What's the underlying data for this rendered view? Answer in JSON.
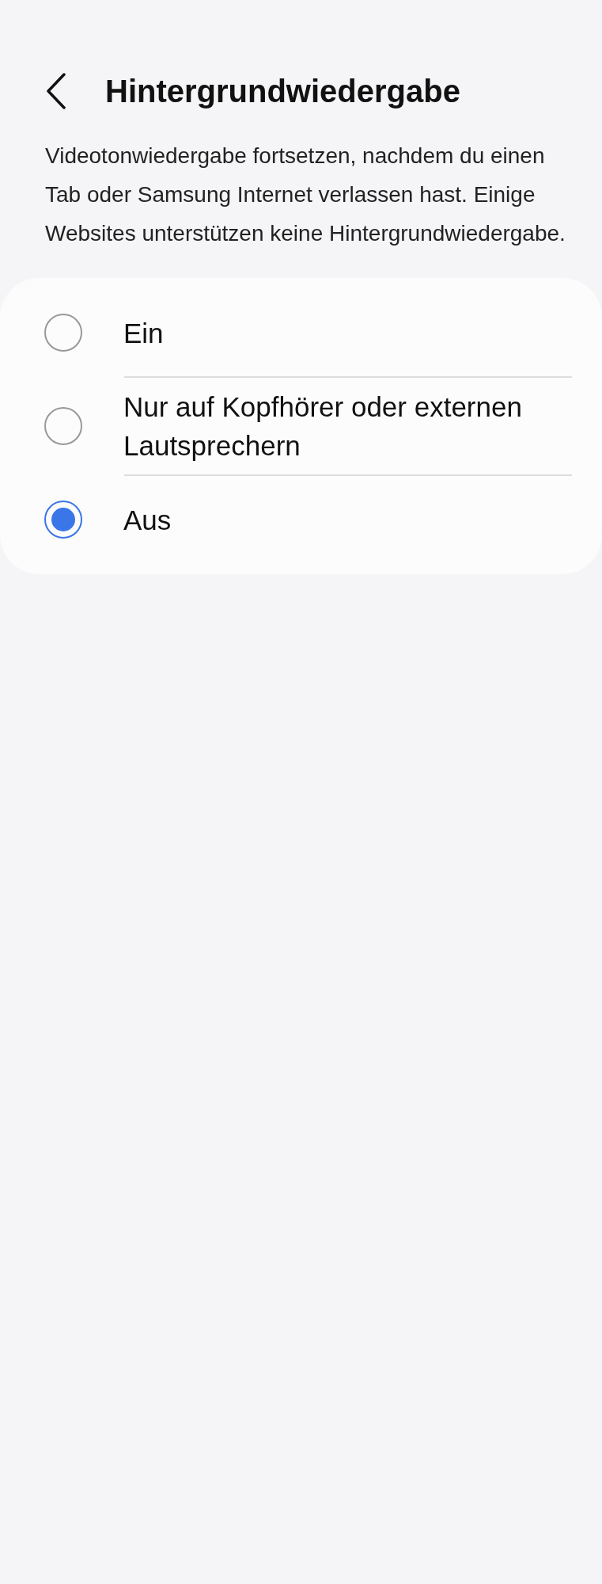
{
  "header": {
    "title": "Hintergrundwiedergabe"
  },
  "description": "Videotonwiedergabe fortsetzen, nachdem du einen Tab oder Samsung Internet verlassen hast. Einige Websites unterstützen keine Hintergrundwiedergabe.",
  "options": [
    {
      "label": "Ein",
      "selected": false
    },
    {
      "label": "Nur auf Kopfhörer oder externen Lautsprechern",
      "selected": false
    },
    {
      "label": "Aus",
      "selected": true
    }
  ]
}
